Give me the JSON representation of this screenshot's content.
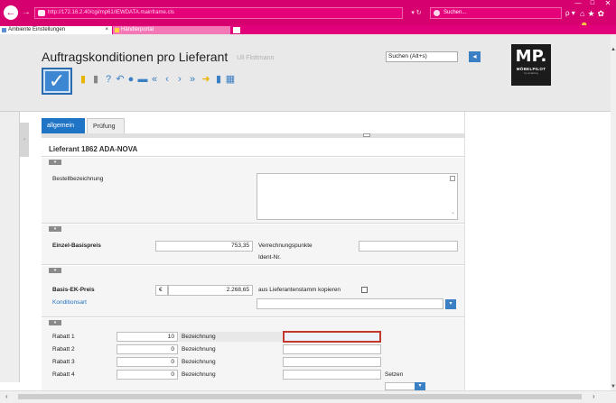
{
  "browser": {
    "url": "http://172.16.2.40/cgi/mp61/IEWDATA.mainframe.cls",
    "search_placeholder": "Suchen...",
    "refresh": "▾ ↻",
    "tabs": [
      {
        "label": "Ambiente Einstellungen",
        "close": "×"
      },
      {
        "label": "Händlerportal",
        "close": ""
      }
    ],
    "win_controls": {
      "min": "—",
      "max": "☐",
      "close": "✕"
    },
    "tool_icons": {
      "search_go": "ρ ▾",
      "home": "⌂",
      "star": "★",
      "gear": "✿",
      "smiley": "☻"
    }
  },
  "header": {
    "title": "Auftragskonditionen pro Lieferant",
    "user": "Uli Flottmann",
    "search_placeholder": "Suchen (Alt+s)",
    "search_btn": "◂",
    "check_label": "✓",
    "logo_mp": "MP.",
    "logo_name": "MÖBELPILOT",
    "logo_tag": "by amazing"
  },
  "toolbar": [
    {
      "name": "bookmark-icon",
      "glyph": "▮",
      "color": "#e8b400"
    },
    {
      "name": "trash-icon",
      "glyph": "▮",
      "color": "#888888"
    },
    {
      "name": "help-icon",
      "glyph": "?",
      "color": "#3b7fc4"
    },
    {
      "name": "undo-icon",
      "glyph": "↶",
      "color": "#3b7fc4"
    },
    {
      "name": "search-icon",
      "glyph": "●",
      "color": "#3b7fc4"
    },
    {
      "name": "print-icon",
      "glyph": "▬",
      "color": "#3b7fc4"
    },
    {
      "name": "first-icon",
      "glyph": "«",
      "color": "#3b7fc4"
    },
    {
      "name": "prev-icon",
      "glyph": "‹",
      "color": "#3b7fc4"
    },
    {
      "name": "next-icon",
      "glyph": "›",
      "color": "#3b7fc4"
    },
    {
      "name": "last-icon",
      "glyph": "»",
      "color": "#3b7fc4"
    },
    {
      "name": "arrow-right-icon",
      "glyph": "➜",
      "color": "#e8b400"
    },
    {
      "name": "document-icon",
      "glyph": "▮",
      "color": "#3b7fc4"
    },
    {
      "name": "spreadsheet-icon",
      "glyph": "▦",
      "color": "#3b7fc4"
    }
  ],
  "form_tabs": {
    "allgemein": "allgemein",
    "pruefung": "Prüfung"
  },
  "form": {
    "lieferant_title": "Lieferant  1862  ADA-NOVA",
    "collapse_glyph": "▾",
    "bestellbezeichnung_label": "Bestellbezeichnung",
    "bestellbezeichnung_value": "",
    "einzel_basispreis_label": "Einzel-Basispreis",
    "einzel_basispreis_value": "753,35",
    "verrechnungspunkte_label": "Verrechnungspunkte",
    "verrechnungspunkte_value": "",
    "ident_nr_label": "Ident-Nr.",
    "basis_ek_preis_label": "Basis-EK-Preis",
    "currency": "€",
    "basis_ek_preis_value": "2.268,65",
    "aus_lieferantenstamm_label": "aus Lieferantenstamm kopieren",
    "konditionsart_label": "Konditionsart",
    "konditionsart_value": "",
    "dropdown_glyph": "▾",
    "rabatte": [
      {
        "label": "Rabatt 1",
        "value": "10",
        "bez_label": "Bezeichnung",
        "bez_value": ""
      },
      {
        "label": "Rabatt 2",
        "value": "0",
        "bez_label": "Bezeichnung",
        "bez_value": ""
      },
      {
        "label": "Rabatt 3",
        "value": "0",
        "bez_label": "Bezeichnung",
        "bez_value": ""
      },
      {
        "label": "Rabatt 4",
        "value": "0",
        "bez_label": "Bezeichnung",
        "bez_value": ""
      }
    ],
    "setzen_label": "Setzen",
    "setzen_value": ""
  },
  "scroll": {
    "up": "▲",
    "down": "▼",
    "left": "‹",
    "right": "›",
    "left_tab": "›"
  },
  "colors": {
    "browser_accent": "#d6006e",
    "primary_blue": "#1f74c6",
    "active_border": "#c0392b"
  }
}
